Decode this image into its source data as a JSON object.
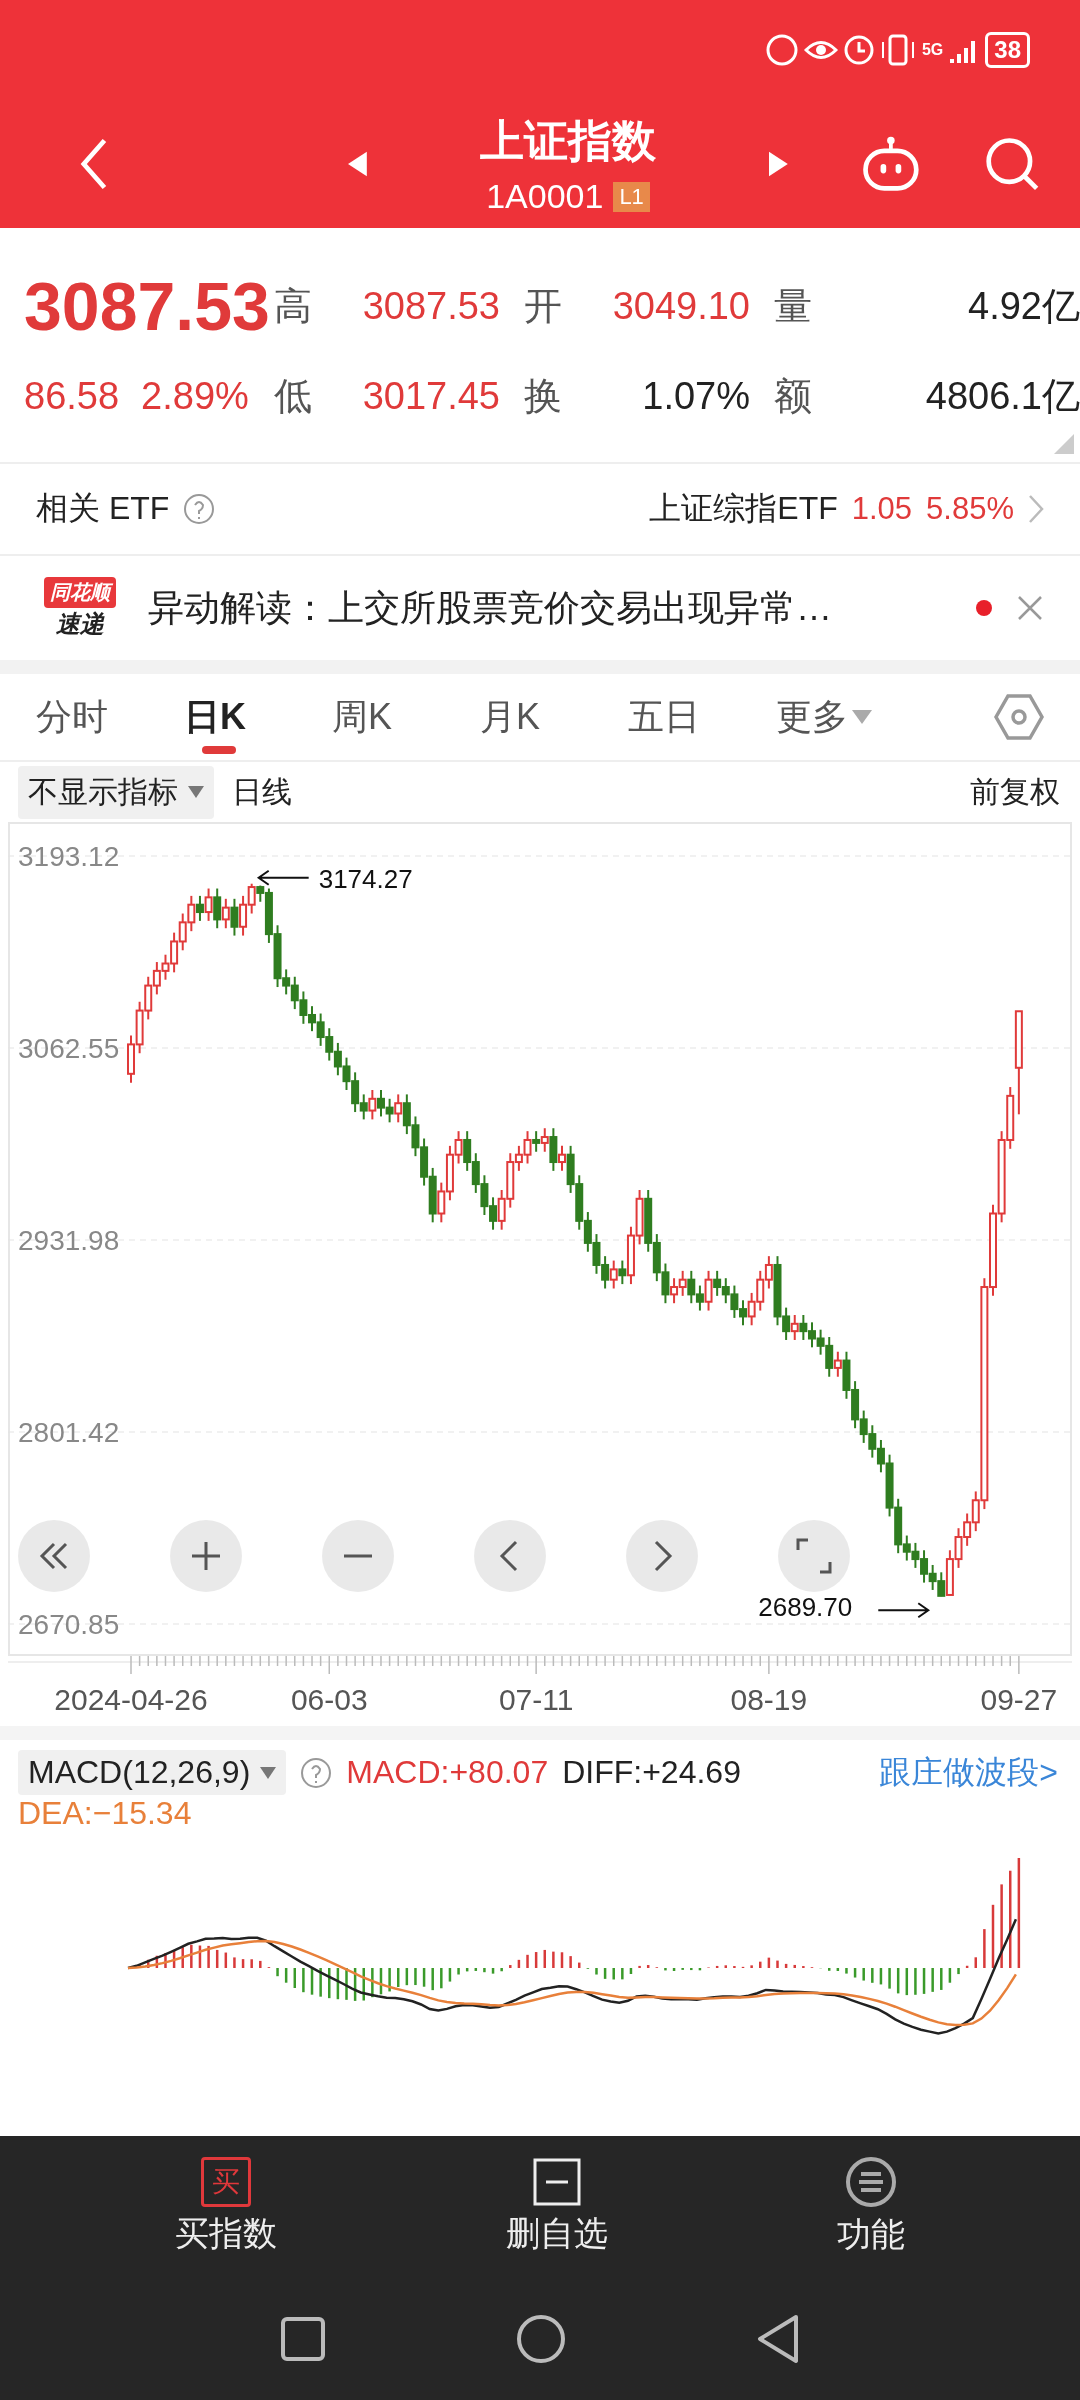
{
  "status_bar": {
    "network": "5G",
    "battery": "38"
  },
  "header": {
    "title": "上证指数",
    "code": "1A0001",
    "level_badge": "L1"
  },
  "quote": {
    "price": "3087.53",
    "change": "86.58",
    "change_pct": "2.89%",
    "stats": [
      {
        "label": "高",
        "value": "3087.53",
        "color": "#e03a3a"
      },
      {
        "label": "开",
        "value": "3049.10",
        "color": "#e03a3a"
      },
      {
        "label": "量",
        "value": "4.92亿",
        "color": "#222222"
      },
      {
        "label": "低",
        "value": "3017.45",
        "color": "#e03a3a"
      },
      {
        "label": "换",
        "value": "1.07%",
        "color": "#222222"
      },
      {
        "label": "额",
        "value": "4806.1亿",
        "color": "#222222"
      }
    ]
  },
  "etf": {
    "label": "相关 ETF",
    "name": "上证综指ETF",
    "price": "1.05",
    "pct": "5.85%"
  },
  "news": {
    "badge_top": "同花顺",
    "badge_bottom": "速递",
    "text": "异动解读：上交所股票竞价交易出现异常…",
    "unread": true
  },
  "tabs": [
    {
      "label": "分时",
      "selected": false,
      "kind": "plain"
    },
    {
      "label": "日K",
      "selected": true,
      "kind": "plain"
    },
    {
      "label": "周K",
      "selected": false,
      "kind": "plain"
    },
    {
      "label": "月K",
      "selected": false,
      "kind": "plain"
    },
    {
      "label": "五日",
      "selected": false,
      "kind": "plain"
    },
    {
      "label": "更多",
      "selected": false,
      "kind": "dropdown"
    }
  ],
  "indicator": {
    "selector": "不显示指标",
    "period": "日线",
    "adjust": "前复权"
  },
  "chart_data": {
    "type": "candlestick",
    "grid": true,
    "categories": [
      "2024-04-26",
      null,
      null,
      null,
      null,
      null,
      null,
      null,
      null,
      null,
      null,
      null,
      null,
      null,
      null,
      null,
      null,
      null,
      null,
      null,
      null,
      null,
      null,
      "06-03",
      null,
      null,
      null,
      null,
      null,
      null,
      null,
      null,
      null,
      null,
      null,
      null,
      null,
      null,
      null,
      null,
      null,
      null,
      null,
      null,
      null,
      null,
      null,
      "07-11",
      null,
      null,
      null,
      null,
      null,
      null,
      null,
      null,
      null,
      null,
      null,
      null,
      null,
      null,
      null,
      null,
      null,
      null,
      null,
      null,
      null,
      null,
      null,
      null,
      null,
      null,
      "08-19",
      null,
      null,
      null,
      null,
      null,
      null,
      null,
      null,
      null,
      null,
      null,
      null,
      null,
      null,
      null,
      null,
      null,
      null,
      null,
      null,
      null,
      null,
      null,
      null,
      null,
      null,
      null,
      null,
      "09-27"
    ],
    "ohlc": [
      [
        3045,
        3071,
        3039,
        3065
      ],
      [
        3065,
        3094,
        3059,
        3088
      ],
      [
        3088,
        3111,
        3082,
        3105
      ],
      [
        3105,
        3121,
        3099,
        3115
      ],
      [
        3115,
        3126,
        3109,
        3120
      ],
      [
        3120,
        3141,
        3114,
        3135
      ],
      [
        3135,
        3154,
        3129,
        3148
      ],
      [
        3148,
        3166,
        3142,
        3160
      ],
      [
        3160,
        3166,
        3149,
        3155
      ],
      [
        3155,
        3171,
        3149,
        3165
      ],
      [
        3165,
        3171,
        3144,
        3150
      ],
      [
        3150,
        3164,
        3144,
        3158
      ],
      [
        3158,
        3164,
        3139,
        3145
      ],
      [
        3145,
        3166,
        3139,
        3160
      ],
      [
        3160,
        3174.27,
        3154,
        3172
      ],
      [
        3172,
        3173,
        3162,
        3168
      ],
      [
        3168,
        3171,
        3134,
        3140
      ],
      [
        3140,
        3146,
        3104,
        3110
      ],
      [
        3110,
        3116,
        3099,
        3105
      ],
      [
        3105,
        3111,
        3089,
        3095
      ],
      [
        3095,
        3101,
        3079,
        3085
      ],
      [
        3085,
        3091,
        3074,
        3080
      ],
      [
        3080,
        3086,
        3064,
        3070
      ],
      [
        3070,
        3076,
        3054,
        3060
      ],
      [
        3060,
        3066,
        3044,
        3050
      ],
      [
        3050,
        3056,
        3034,
        3040
      ],
      [
        3040,
        3046,
        3019,
        3025
      ],
      [
        3025,
        3031,
        3014,
        3020
      ],
      [
        3020,
        3034,
        3014,
        3028
      ],
      [
        3028,
        3034,
        3016,
        3022
      ],
      [
        3022,
        3028,
        3012,
        3018
      ],
      [
        3018,
        3031,
        3012,
        3025
      ],
      [
        3025,
        3031,
        3004,
        3010
      ],
      [
        3010,
        3016,
        2989,
        2995
      ],
      [
        2995,
        3001,
        2969,
        2975
      ],
      [
        2975,
        2981,
        2944,
        2950
      ],
      [
        2950,
        2971,
        2944,
        2965
      ],
      [
        2965,
        2996,
        2959,
        2990
      ],
      [
        2990,
        3006,
        2984,
        3000
      ],
      [
        3000,
        3006,
        2979,
        2985
      ],
      [
        2985,
        2991,
        2964,
        2970
      ],
      [
        2970,
        2976,
        2949,
        2955
      ],
      [
        2955,
        2961,
        2939,
        2945
      ],
      [
        2945,
        2966,
        2939,
        2960
      ],
      [
        2960,
        2991,
        2954,
        2985
      ],
      [
        2985,
        2996,
        2979,
        2990
      ],
      [
        2990,
        3006,
        2984,
        3000
      ],
      [
        3000,
        3006,
        2992,
        2998
      ],
      [
        2998,
        3008,
        2992,
        3002
      ],
      [
        3002,
        3008,
        2979,
        2985
      ],
      [
        2985,
        2996,
        2979,
        2990
      ],
      [
        2990,
        2996,
        2964,
        2970
      ],
      [
        2970,
        2976,
        2939,
        2945
      ],
      [
        2945,
        2951,
        2924,
        2930
      ],
      [
        2930,
        2936,
        2909,
        2915
      ],
      [
        2915,
        2921,
        2899,
        2905
      ],
      [
        2905,
        2918,
        2899,
        2912
      ],
      [
        2912,
        2918,
        2902,
        2908
      ],
      [
        2908,
        2941,
        2902,
        2935
      ],
      [
        2935,
        2966,
        2929,
        2960
      ],
      [
        2960,
        2966,
        2924,
        2930
      ],
      [
        2930,
        2936,
        2904,
        2910
      ],
      [
        2910,
        2916,
        2889,
        2895
      ],
      [
        2895,
        2906,
        2889,
        2900
      ],
      [
        2900,
        2911,
        2894,
        2905
      ],
      [
        2905,
        2911,
        2889,
        2895
      ],
      [
        2895,
        2901,
        2884,
        2890
      ],
      [
        2890,
        2911,
        2884,
        2905
      ],
      [
        2905,
        2911,
        2894,
        2900
      ],
      [
        2900,
        2906,
        2889,
        2895
      ],
      [
        2895,
        2901,
        2879,
        2885
      ],
      [
        2885,
        2891,
        2874,
        2880
      ],
      [
        2880,
        2896,
        2874,
        2890
      ],
      [
        2890,
        2911,
        2884,
        2905
      ],
      [
        2905,
        2921,
        2899,
        2915
      ],
      [
        2915,
        2921,
        2874,
        2880
      ],
      [
        2880,
        2886,
        2864,
        2870
      ],
      [
        2870,
        2881,
        2864,
        2875
      ],
      [
        2875,
        2881,
        2864,
        2870
      ],
      [
        2870,
        2876,
        2859,
        2865
      ],
      [
        2865,
        2871,
        2854,
        2860
      ],
      [
        2860,
        2866,
        2839,
        2845
      ],
      [
        2845,
        2856,
        2839,
        2850
      ],
      [
        2850,
        2856,
        2824,
        2830
      ],
      [
        2830,
        2836,
        2804,
        2810
      ],
      [
        2810,
        2816,
        2794,
        2800
      ],
      [
        2800,
        2806,
        2784,
        2790
      ],
      [
        2790,
        2796,
        2774,
        2780
      ],
      [
        2780,
        2786,
        2744,
        2750
      ],
      [
        2750,
        2756,
        2719,
        2725
      ],
      [
        2725,
        2731,
        2714,
        2720
      ],
      [
        2720,
        2726,
        2709,
        2715
      ],
      [
        2715,
        2721,
        2699,
        2705
      ],
      [
        2705,
        2711,
        2694,
        2700
      ],
      [
        2700,
        2706,
        2689.7,
        2690
      ],
      [
        2690.6,
        2721,
        2690.5,
        2715
      ],
      [
        2715,
        2736,
        2709,
        2730
      ],
      [
        2730,
        2746,
        2724,
        2740
      ],
      [
        2740,
        2761,
        2734,
        2755
      ],
      [
        2755,
        2906,
        2749,
        2900
      ],
      [
        2900,
        2956,
        2894,
        2950
      ],
      [
        2950,
        3006,
        2944,
        3000
      ],
      [
        3000,
        3036,
        2994,
        3030
      ],
      [
        3049.1,
        3087.53,
        3017.45,
        3087.53
      ]
    ],
    "ylim": [
      2650.45,
      3216.24
    ],
    "yticks": [
      3193.12,
      3062.55,
      2931.98,
      2801.42,
      2670.85
    ],
    "annotations": [
      "3174.27",
      "2689.70"
    ]
  },
  "macd": {
    "selector": "MACD(12,26,9)",
    "macd": "MACD:+80.07",
    "diff": "DIFF:+24.69",
    "link": "跟庄做波段>",
    "dea": "DEA:−15.34"
  },
  "bottom_nav": [
    {
      "label": "买指数",
      "kind": "buy",
      "icon_text": "买"
    },
    {
      "label": "删自选",
      "kind": "remove"
    },
    {
      "label": "功能",
      "kind": "menu"
    }
  ]
}
